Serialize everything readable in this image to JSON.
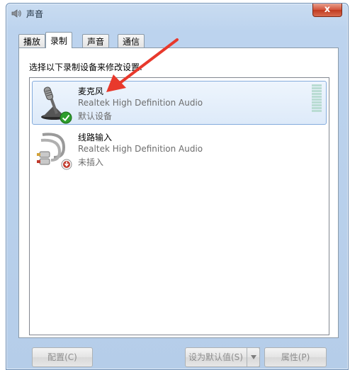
{
  "window": {
    "title": "声音",
    "close_label": "x"
  },
  "tabs": [
    {
      "label": "播放",
      "active": false
    },
    {
      "label": "录制",
      "active": true
    },
    {
      "label": "声音",
      "active": false
    },
    {
      "label": "通信",
      "active": false
    }
  ],
  "instruction": "选择以下录制设备来修改设置:",
  "devices": [
    {
      "name": "麦克风",
      "driver": "Realtek High Definition Audio",
      "status": "默认设备",
      "icon": "microphone-icon",
      "badge": "default-check-icon",
      "selected": true
    },
    {
      "name": "线路输入",
      "driver": "Realtek High Definition Audio",
      "status": "未插入",
      "icon": "line-in-cable-icon",
      "badge": "unplugged-icon",
      "selected": false
    }
  ],
  "buttons": {
    "configure": "配置(C)",
    "set_default": "设为默认值(S)",
    "properties": "属性(P)"
  },
  "colors": {
    "accent_arrow": "#e8392c",
    "selection": "#ddeaf9",
    "meter": "#b9dcd3"
  }
}
